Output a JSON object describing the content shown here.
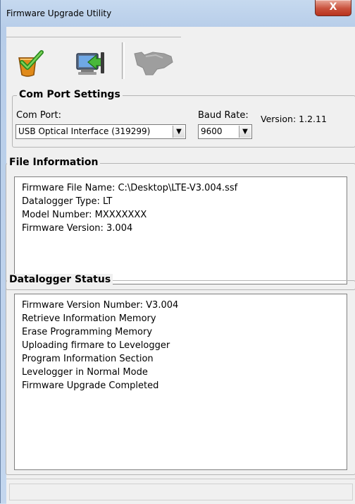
{
  "window": {
    "title": "Firmware Upgrade Utility",
    "close_label": "X"
  },
  "toolbar": {
    "buttons": [
      {
        "icon": "read-checkmark-icon"
      },
      {
        "icon": "upload-computer-icon"
      },
      {
        "icon": "device-disabled-icon"
      }
    ]
  },
  "com_port_settings": {
    "title": "Com Port Settings",
    "com_port_label": "Com Port:",
    "com_port_value": "USB Optical Interface (319299)",
    "baud_rate_label": "Baud Rate:",
    "baud_rate_value": "9600",
    "version_text": "Version: 1.2.11"
  },
  "file_information": {
    "title": "File Information",
    "lines": [
      "Firmware File Name: C:\\Desktop\\LTE-V3.004.ssf",
      "Datalogger Type: LT",
      "Model Number: MXXXXXXX",
      "Firmware Version: 3.004"
    ]
  },
  "datalogger_status": {
    "title": "Datalogger Status",
    "lines": [
      "Firmware Version Number: V3.004",
      "Retrieve Information Memory",
      "Erase Programming Memory",
      "Uploading firmare to Levelogger",
      "Program Information Section",
      "Levelogger in Normal Mode",
      "Firmware Upgrade Completed"
    ]
  },
  "colors": {
    "frame": "#c3d6ee",
    "client": "#f0f0f0",
    "close_button": "#c9513c"
  }
}
